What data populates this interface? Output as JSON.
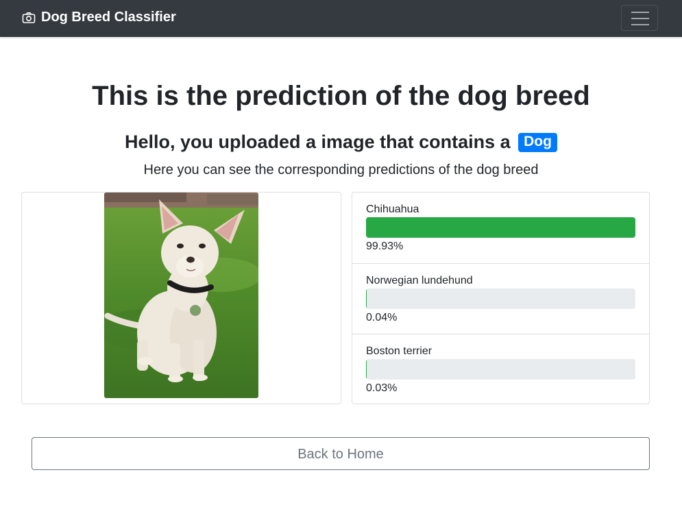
{
  "navbar": {
    "brand": "Dog Breed Classifier",
    "brand_icon": "camera-icon",
    "menu_icon": "hamburger-menu-icon"
  },
  "page": {
    "title": "This is the prediction of the dog breed",
    "subtitle_prefix": "Hello, you uploaded a image that contains a",
    "detected_label": "Dog",
    "lead": "Here you can see the corresponding predictions of the dog breed"
  },
  "predictions": [
    {
      "breed": "Chihuahua",
      "percent_label": "99.93%",
      "value": 0.9993
    },
    {
      "breed": "Norwegian lundehund",
      "percent_label": "0.04%",
      "value": 0.0004
    },
    {
      "breed": "Boston terrier",
      "percent_label": "0.03%",
      "value": 0.0003
    }
  ],
  "actions": {
    "back_home": "Back to Home"
  },
  "colors": {
    "navbar": "#343a40",
    "badge": "#007bff",
    "progress_fill": "#28a745",
    "progress_track": "#e9ecef",
    "button_outline": "#6c757d"
  }
}
